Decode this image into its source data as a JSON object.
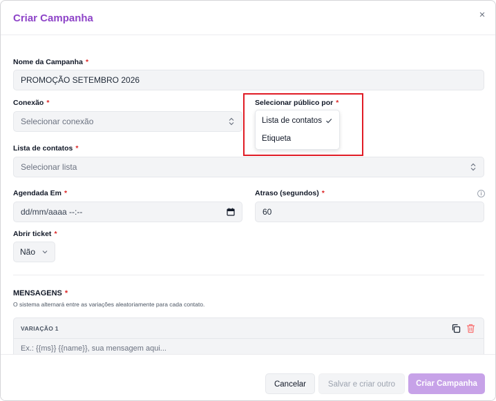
{
  "modal": {
    "title": "Criar Campanha",
    "close_glyph": "×"
  },
  "required_mark": "*",
  "form": {
    "campaign_name": {
      "label": "Nome da Campanha",
      "value": "PROMOÇÃO SETEMBRO 2026"
    },
    "connection": {
      "label": "Conexão",
      "placeholder": "Selecionar conexão"
    },
    "audience": {
      "label": "Selecionar público por",
      "options": [
        {
          "label": "Lista de contatos",
          "selected": true
        },
        {
          "label": "Etiqueta",
          "selected": false
        }
      ]
    },
    "contact_list": {
      "label": "Lista de contatos",
      "placeholder": "Selecionar lista"
    },
    "scheduled_at": {
      "label": "Agendada Em",
      "value": "dd/mm/aaaa --:--"
    },
    "delay": {
      "label": "Atraso (segundos)",
      "value": "60"
    },
    "open_ticket": {
      "label": "Abrir ticket",
      "value": "Não"
    }
  },
  "messages": {
    "heading": "MENSAGENS",
    "description": "O sistema alternará entre as variações aleatoriamente para cada contato.",
    "variation": {
      "label": "VARIAÇÃO 1",
      "placeholder": "Ex.: {{ms}} {{name}}, sua mensagem aqui..."
    }
  },
  "footer": {
    "cancel_label": "Cancelar",
    "save_label": "Salvar e criar outro",
    "create_label": "Criar Campanha"
  },
  "colors": {
    "accent": "#8e44c8",
    "required": "#dc2626",
    "highlight": "#e01b24",
    "primary_disabled": "#c7a2e8"
  },
  "icons": [
    "close-icon",
    "chevron-up-down-icon",
    "calendar-icon",
    "info-icon",
    "check-icon",
    "chevron-down-icon",
    "copy-icon",
    "trash-icon"
  ]
}
